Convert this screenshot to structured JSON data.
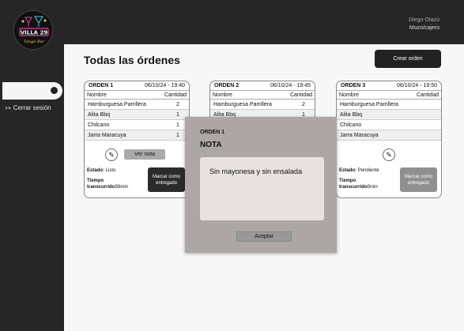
{
  "brand": {
    "name": "VILLA 29",
    "tagline": "Tango Bar"
  },
  "user": {
    "name": "Diego Otazú",
    "role": "Mozo/cajero"
  },
  "sidebar": {
    "logout_label": "Cerrar sesión",
    "logout_icon": "logout-icon"
  },
  "page": {
    "title": "Todas las órdenes",
    "create_label": "Crear orden"
  },
  "orders": [
    {
      "id": "ORDEN 1",
      "datetime": "06/10/24 - 19:40",
      "col_name": "Nombre",
      "col_qty": "Cantidad",
      "items": [
        {
          "name": "Hamburguesa Parrillera",
          "qty": "2"
        },
        {
          "name": "Alita Bbq",
          "qty": "1"
        },
        {
          "name": "Chilcano",
          "qty": "1"
        },
        {
          "name": "Jarra Maracuya",
          "qty": "1"
        }
      ],
      "note_label": "Ver nota",
      "estado_label": "Estado:",
      "estado_value": "Listo",
      "tiempo_label": "Tiempo transcurrido:",
      "tiempo_value": "38min",
      "mark_label": "Marcar como entregado",
      "mark_color": "#2b2b2b"
    },
    {
      "id": "ORDEN 2",
      "datetime": "06/10/24 - 19:45",
      "col_name": "Nombre",
      "col_qty": "Cantidad",
      "items": [
        {
          "name": "Hamburguesa Parrillera",
          "qty": "2"
        },
        {
          "name": "Alita Bbq",
          "qty": "1"
        }
      ]
    },
    {
      "id": "ORDEN 3",
      "datetime": "06/10/24 - 19:50",
      "col_name": "Nombre",
      "col_qty": "Cantidad",
      "items": [
        {
          "name": "Hamburguesa Parrillera",
          "qty": ""
        },
        {
          "name": "Alita Bbq",
          "qty": ""
        },
        {
          "name": "Chilcano",
          "qty": ""
        },
        {
          "name": "Jarra Maracuya",
          "qty": ""
        }
      ],
      "estado_label": "Estado:",
      "estado_value": "Pendiente",
      "tiempo_label": "Tiempo transcurrido:",
      "tiempo_value": "0min",
      "mark_label": "Marcar como entregado",
      "mark_color": "#8f8f8f"
    }
  ],
  "modal": {
    "subtitle": "ORDEN 1",
    "title": "NOTA",
    "text": "Sin mayonesa y sin ensalada",
    "accept_label": "Aceptar"
  }
}
